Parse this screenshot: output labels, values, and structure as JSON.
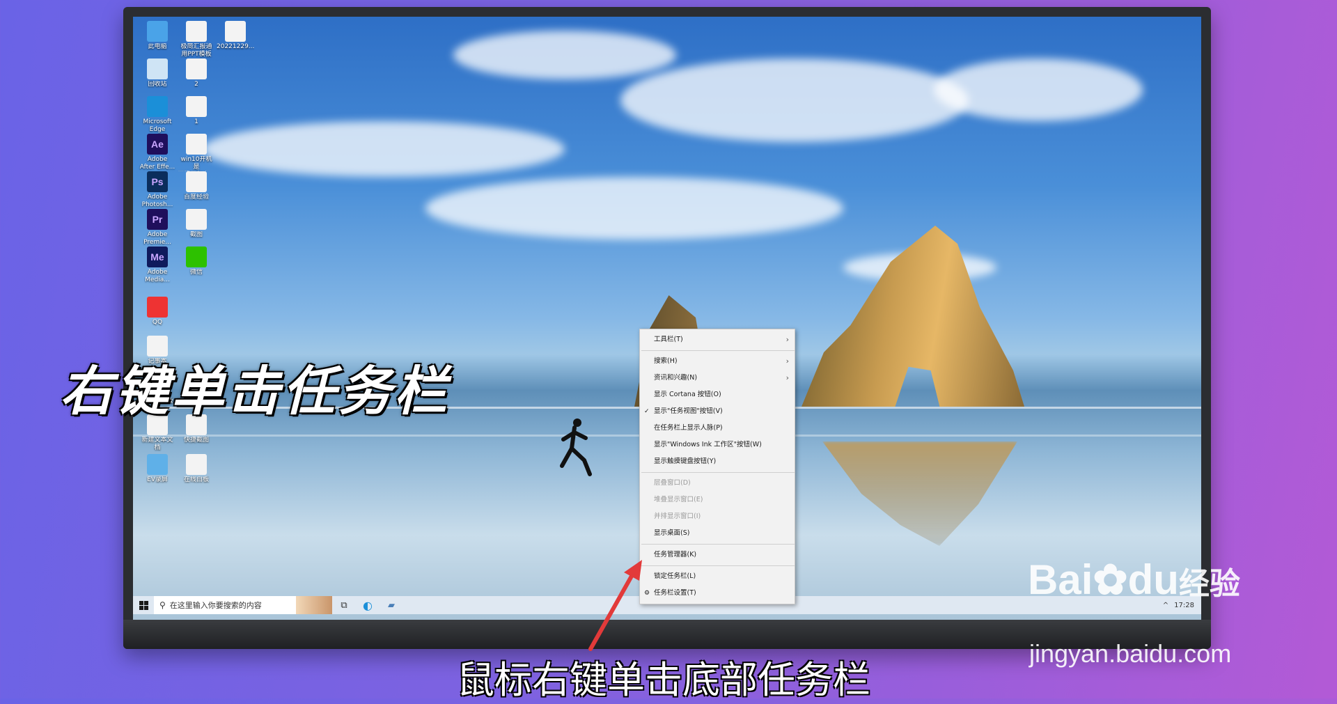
{
  "overlay": {
    "title": "右键单击任务栏",
    "caption": "鼠标右键单击底部任务栏"
  },
  "desktop_icons": [
    {
      "label": "此电脑",
      "icon": "computer-icon"
    },
    {
      "label": "极简汇报通\n用PPT模板",
      "icon": "ppt-file-icon"
    },
    {
      "label": "20221229...",
      "icon": "image-file-icon"
    },
    {
      "label": "回收站",
      "icon": "recycle-bin-icon"
    },
    {
      "label": "2",
      "icon": "image-file-icon"
    },
    {
      "label": "Microsoft\nEdge",
      "icon": "edge-icon"
    },
    {
      "label": "1",
      "icon": "image-file-icon"
    },
    {
      "label": "Adobe\nAfter Effe...",
      "icon": "after-effects-icon",
      "glyph": "Ae"
    },
    {
      "label": "win10开机是\n否提示怎么...",
      "icon": "document-icon"
    },
    {
      "label": "Adobe\nPhotosh...",
      "icon": "photoshop-icon",
      "glyph": "Ps"
    },
    {
      "label": "百度经验",
      "icon": "wps-document-icon"
    },
    {
      "label": "Adobe\nPremie...",
      "icon": "premiere-icon",
      "glyph": "Pr"
    },
    {
      "label": "截图",
      "icon": "image-file-icon"
    },
    {
      "label": "Adobe\nMedia...",
      "icon": "media-encoder-icon",
      "glyph": "Me"
    },
    {
      "label": "微信",
      "icon": "wechat-icon"
    },
    {
      "label": "QQ",
      "icon": "qq-icon"
    },
    {
      "label": "记事本",
      "icon": "wps-document-icon"
    },
    {
      "label": "剪映专业版",
      "icon": "capcut-icon"
    },
    {
      "label": "手机投屏",
      "icon": "phone-icon"
    },
    {
      "label": "新建文本文\n档",
      "icon": "document-icon"
    },
    {
      "label": "快捷截图",
      "icon": "image-file-icon"
    },
    {
      "label": "EV录屏",
      "icon": "ev-recorder-icon"
    },
    {
      "label": "在线白板",
      "icon": "whiteboard-icon"
    }
  ],
  "taskbar": {
    "search_placeholder": "在这里输入你要搜索的内容",
    "time": "17:28"
  },
  "context_menu": {
    "groups": [
      [
        {
          "label": "工具栏(T)",
          "submenu": true,
          "checked": false,
          "disabled": false
        }
      ],
      [
        {
          "label": "搜索(H)",
          "submenu": true,
          "checked": false,
          "disabled": false
        },
        {
          "label": "资讯和兴趣(N)",
          "submenu": true,
          "checked": false,
          "disabled": false
        },
        {
          "label": "显示 Cortana 按钮(O)",
          "submenu": false,
          "checked": false,
          "disabled": false
        },
        {
          "label": "显示\"任务视图\"按钮(V)",
          "submenu": false,
          "checked": true,
          "disabled": false
        },
        {
          "label": "在任务栏上显示人脉(P)",
          "submenu": false,
          "checked": false,
          "disabled": false
        },
        {
          "label": "显示\"Windows Ink 工作区\"按钮(W)",
          "submenu": false,
          "checked": false,
          "disabled": false
        },
        {
          "label": "显示触摸键盘按钮(Y)",
          "submenu": false,
          "checked": false,
          "disabled": false
        }
      ],
      [
        {
          "label": "层叠窗口(D)",
          "submenu": false,
          "checked": false,
          "disabled": true
        },
        {
          "label": "堆叠显示窗口(E)",
          "submenu": false,
          "checked": false,
          "disabled": true
        },
        {
          "label": "并排显示窗口(I)",
          "submenu": false,
          "checked": false,
          "disabled": true
        },
        {
          "label": "显示桌面(S)",
          "submenu": false,
          "checked": false,
          "disabled": false
        }
      ],
      [
        {
          "label": "任务管理器(K)",
          "submenu": false,
          "checked": false,
          "disabled": false
        }
      ],
      [
        {
          "label": "锁定任务栏(L)",
          "submenu": false,
          "checked": false,
          "disabled": false
        },
        {
          "label": "任务栏设置(T)",
          "submenu": false,
          "checked": false,
          "disabled": false,
          "icon": "gear-icon"
        }
      ]
    ]
  },
  "watermark": {
    "brand": "Bai",
    "brand_suffix": "du",
    "sub": "经验",
    "url": "jingyan.baidu.com"
  }
}
